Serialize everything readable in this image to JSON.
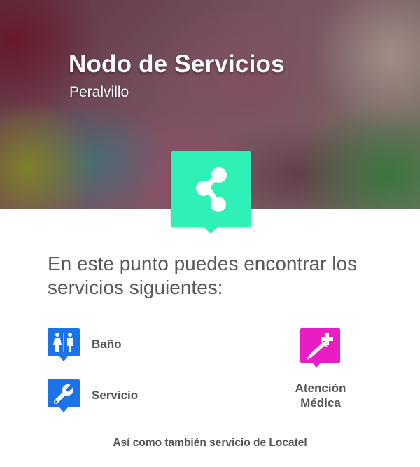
{
  "header": {
    "title": "Nodo de Servicios",
    "subtitle": "Peralvillo"
  },
  "node_icon": {
    "name": "share-node-icon",
    "color": "#2ff0b6"
  },
  "intro_text": "En este punto puedes encontrar los servicios siguientes:",
  "services": [
    {
      "label": "Baño",
      "icon": "restroom-icon",
      "color": "#1a73e8"
    },
    {
      "label": "Servicio",
      "icon": "wrench-icon",
      "color": "#1a73e8"
    },
    {
      "label": "Atención Médica",
      "icon": "medical-syringe-icon",
      "color": "#e81ec2"
    }
  ],
  "footer_text": "Así como también servicio de Locatel"
}
